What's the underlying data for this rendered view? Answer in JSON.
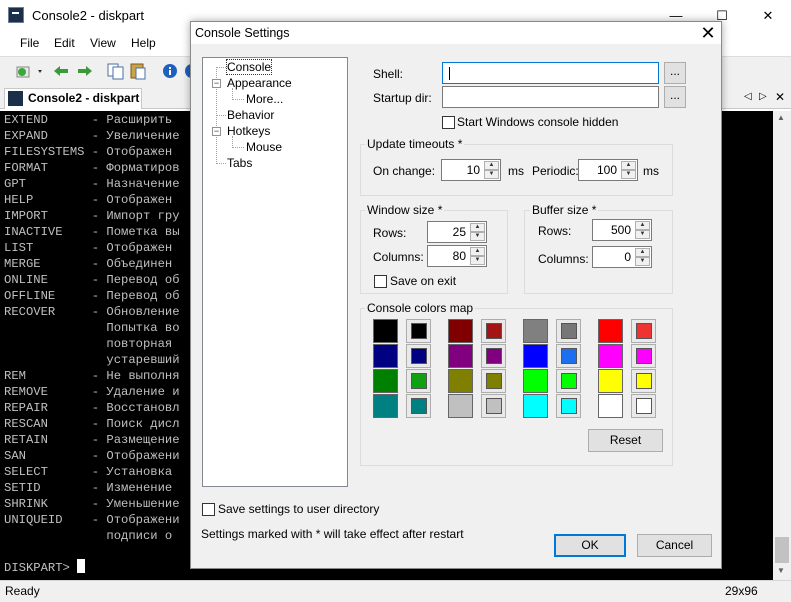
{
  "app": {
    "title": "Console2 - diskpart",
    "menu": [
      "File",
      "Edit",
      "View",
      "Help"
    ],
    "tab_label": "Console2 - diskpart",
    "status_text": "Ready",
    "status_size": "29x96",
    "console_lines": [
      "EXTEND      - Расширить",
      "EXPAND      - Увеличение",
      "FILESYSTEMS - Отображен",
      "FORMAT      - Форматиров",
      "GPT         - Назначение",
      "HELP        - Отображен",
      "IMPORT      - Импорт гру",
      "INACTIVE    - Пометка вы",
      "LIST        - Отображен",
      "MERGE       - Объединен",
      "ONLINE      - Перевод об",
      "OFFLINE     - Перевод об",
      "RECOVER     - Обновление",
      "              Попытка во",
      "              повторная",
      "              устаревший",
      "REM         - Не выполня",
      "REMOVE      - Удаление и",
      "REPAIR      - Восстановл",
      "RESCAN      - Поиск дисл",
      "RETAIN      - Размещение",
      "SAN         - Отображени",
      "SELECT      - Установка",
      "SETID       - Изменение",
      "SHRINK      - Уменьшение",
      "UNIQUEID    - Отображени",
      "              подписи о"
    ],
    "prompt": "DISKPART> "
  },
  "dialog": {
    "title": "Console Settings",
    "close_glyph": "✕",
    "tree": {
      "console": "Console",
      "appearance": "Appearance",
      "more": "More...",
      "behavior": "Behavior",
      "hotkeys": "Hotkeys",
      "mouse": "Mouse",
      "tabs": "Tabs"
    },
    "shell_label": "Shell:",
    "shell_value": "",
    "startup_label": "Startup dir:",
    "startup_value": "",
    "browse_label": "...",
    "hidden_label": "Start Windows console hidden",
    "update": {
      "title": "Update timeouts *",
      "on_change_label": "On change:",
      "on_change_value": "10",
      "periodic_label": "Periodic:",
      "periodic_value": "100",
      "unit": "ms"
    },
    "window_size": {
      "title": "Window size *",
      "rows_label": "Rows:",
      "rows_value": "25",
      "columns_label": "Columns:",
      "columns_value": "80",
      "save_on_exit": "Save on exit"
    },
    "buffer_size": {
      "title": "Buffer size *",
      "rows_label": "Rows:",
      "rows_value": "500",
      "columns_label": "Columns:",
      "columns_value": "0"
    },
    "colors": {
      "title": "Console colors map",
      "reset_label": "Reset",
      "palette": [
        "#000000",
        "#800000",
        "#808080",
        "#ff0000",
        "#000080",
        "#800080",
        "#0000ff",
        "#ff00ff",
        "#008000",
        "#808000",
        "#00ff00",
        "#ffff00",
        "#008080",
        "#c0c0c0",
        "#00ffff",
        "#ffffff"
      ],
      "palette_small": [
        "#000000",
        "#a31515",
        "#777777",
        "#ee3333",
        "#000080",
        "#800080",
        "#1e6ff0",
        "#ff00ff",
        "#10a010",
        "#808000",
        "#00ff00",
        "#ffff00",
        "#008080",
        "#c0c0c0",
        "#00ffff",
        "#ffffff"
      ]
    },
    "save_user_dir": "Save settings to user directory",
    "restart_note": "Settings marked with * will take effect after restart",
    "ok_label": "OK",
    "cancel_label": "Cancel"
  }
}
